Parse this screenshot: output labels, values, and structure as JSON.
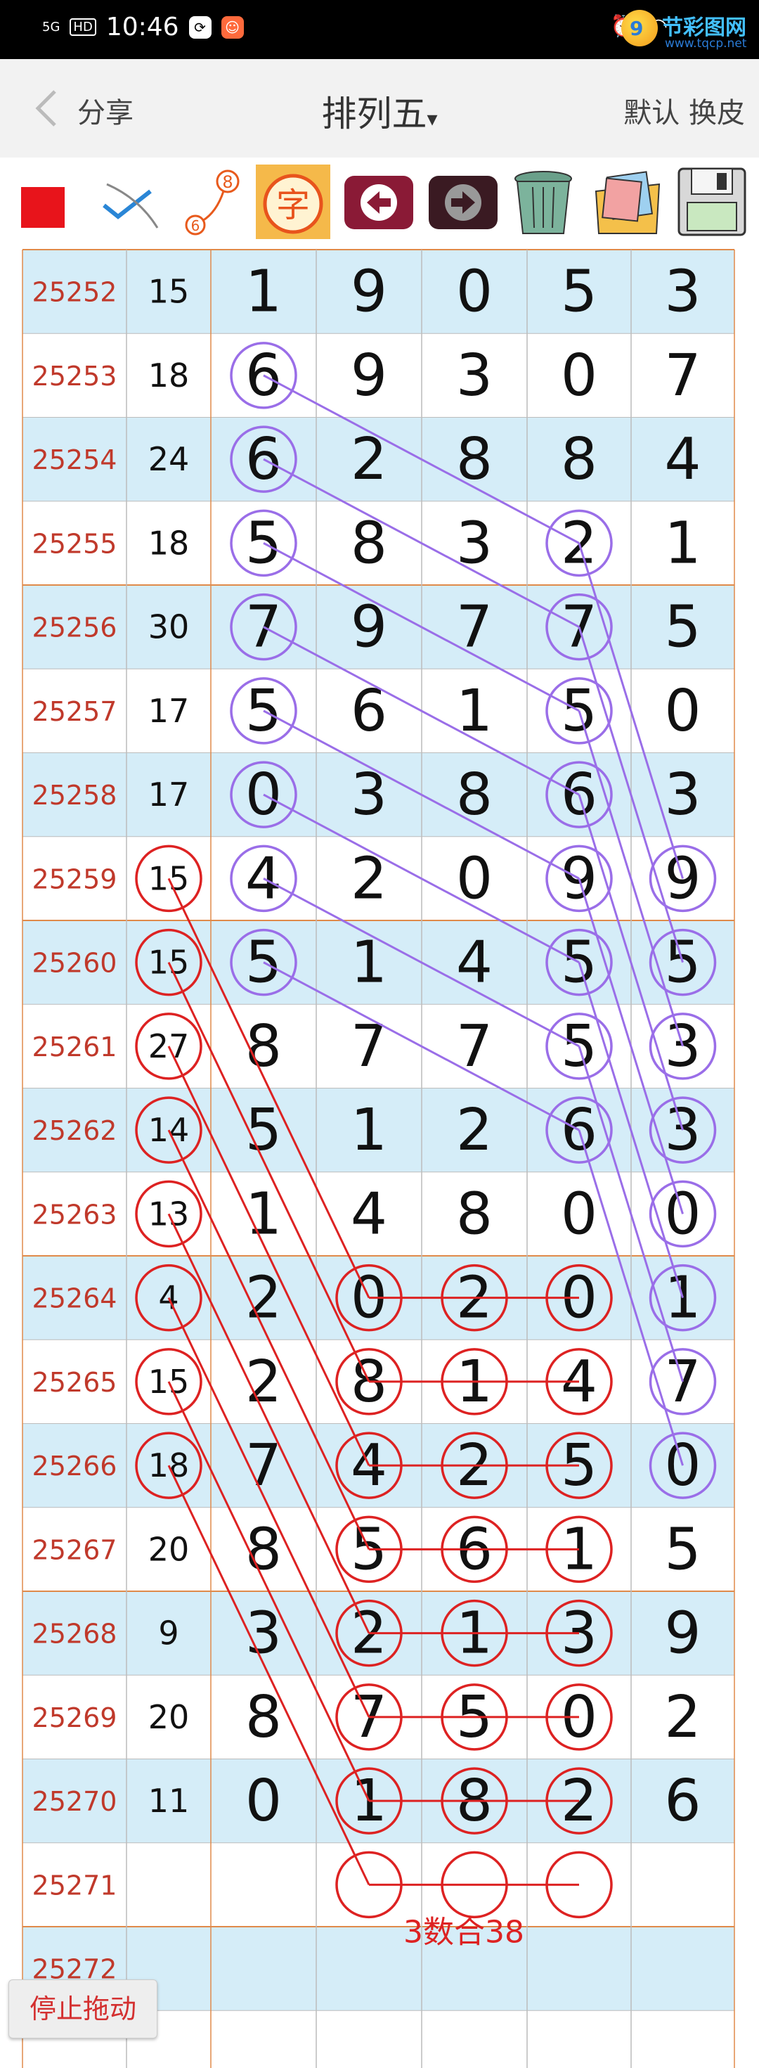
{
  "statusbar": {
    "signal": "5G",
    "hd": "HD",
    "time": "10:46"
  },
  "watermark": {
    "brand": "节彩图网",
    "url": "www.tqcp.net",
    "logo_char": "9"
  },
  "navbar": {
    "share": "分享",
    "title": "排列五",
    "title_caret": "▾",
    "right": "默认 换皮"
  },
  "toolbar": {
    "icons": [
      "red-square-icon",
      "check-pen-icon",
      "pick-number-icon",
      "zi-char-icon",
      "arrow-left-icon",
      "arrow-right-icon",
      "trash-can-icon",
      "photo-icon",
      "save-disk-icon"
    ],
    "pick_number_label": "8",
    "pick_number_small": "6",
    "zi_char": "字"
  },
  "colors": {
    "issue_text": "#c0392b",
    "row_blue": "#d5edf8",
    "row_white": "#ffffff",
    "grid_line": "#bcbcbc",
    "group_line": "#e08a4a",
    "circle_red": "#dd2222",
    "circle_purple": "#9a6ee8"
  },
  "table": {
    "rows": [
      {
        "issue": "25252",
        "sum": "15",
        "digits": [
          "1",
          "9",
          "0",
          "5",
          "3"
        ]
      },
      {
        "issue": "25253",
        "sum": "18",
        "digits": [
          "6",
          "9",
          "3",
          "0",
          "7"
        ]
      },
      {
        "issue": "25254",
        "sum": "24",
        "digits": [
          "6",
          "2",
          "8",
          "8",
          "4"
        ]
      },
      {
        "issue": "25255",
        "sum": "18",
        "digits": [
          "5",
          "8",
          "3",
          "2",
          "1"
        ]
      },
      {
        "issue": "25256",
        "sum": "30",
        "digits": [
          "7",
          "9",
          "7",
          "7",
          "5"
        ]
      },
      {
        "issue": "25257",
        "sum": "17",
        "digits": [
          "5",
          "6",
          "1",
          "5",
          "0"
        ]
      },
      {
        "issue": "25258",
        "sum": "17",
        "digits": [
          "0",
          "3",
          "8",
          "6",
          "3"
        ]
      },
      {
        "issue": "25259",
        "sum": "15",
        "digits": [
          "4",
          "2",
          "0",
          "9",
          "9"
        ]
      },
      {
        "issue": "25260",
        "sum": "15",
        "digits": [
          "5",
          "1",
          "4",
          "5",
          "5"
        ]
      },
      {
        "issue": "25261",
        "sum": "27",
        "digits": [
          "8",
          "7",
          "7",
          "5",
          "3"
        ]
      },
      {
        "issue": "25262",
        "sum": "14",
        "digits": [
          "5",
          "1",
          "2",
          "6",
          "3"
        ]
      },
      {
        "issue": "25263",
        "sum": "13",
        "digits": [
          "1",
          "4",
          "8",
          "0",
          "0"
        ]
      },
      {
        "issue": "25264",
        "sum": "4",
        "digits": [
          "2",
          "0",
          "2",
          "0",
          "1"
        ]
      },
      {
        "issue": "25265",
        "sum": "15",
        "digits": [
          "2",
          "8",
          "1",
          "4",
          "7"
        ]
      },
      {
        "issue": "25266",
        "sum": "18",
        "digits": [
          "7",
          "4",
          "2",
          "5",
          "0"
        ]
      },
      {
        "issue": "25267",
        "sum": "20",
        "digits": [
          "8",
          "5",
          "6",
          "1",
          "5"
        ]
      },
      {
        "issue": "25268",
        "sum": "9",
        "digits": [
          "3",
          "2",
          "1",
          "3",
          "9"
        ]
      },
      {
        "issue": "25269",
        "sum": "20",
        "digits": [
          "8",
          "7",
          "5",
          "0",
          "2"
        ]
      },
      {
        "issue": "25270",
        "sum": "11",
        "digits": [
          "0",
          "1",
          "8",
          "2",
          "6"
        ]
      },
      {
        "issue": "25271",
        "sum": "",
        "digits": [
          "",
          "",
          "",
          "",
          ""
        ]
      },
      {
        "issue": "25272",
        "sum": "",
        "digits": [
          "",
          "",
          "",
          "",
          ""
        ]
      },
      {
        "issue": "",
        "sum": "",
        "digits": [
          "",
          "",
          "",
          "",
          ""
        ]
      }
    ]
  },
  "annotation": {
    "text": "3数合38"
  },
  "float_button": {
    "label": "停止拖动"
  }
}
